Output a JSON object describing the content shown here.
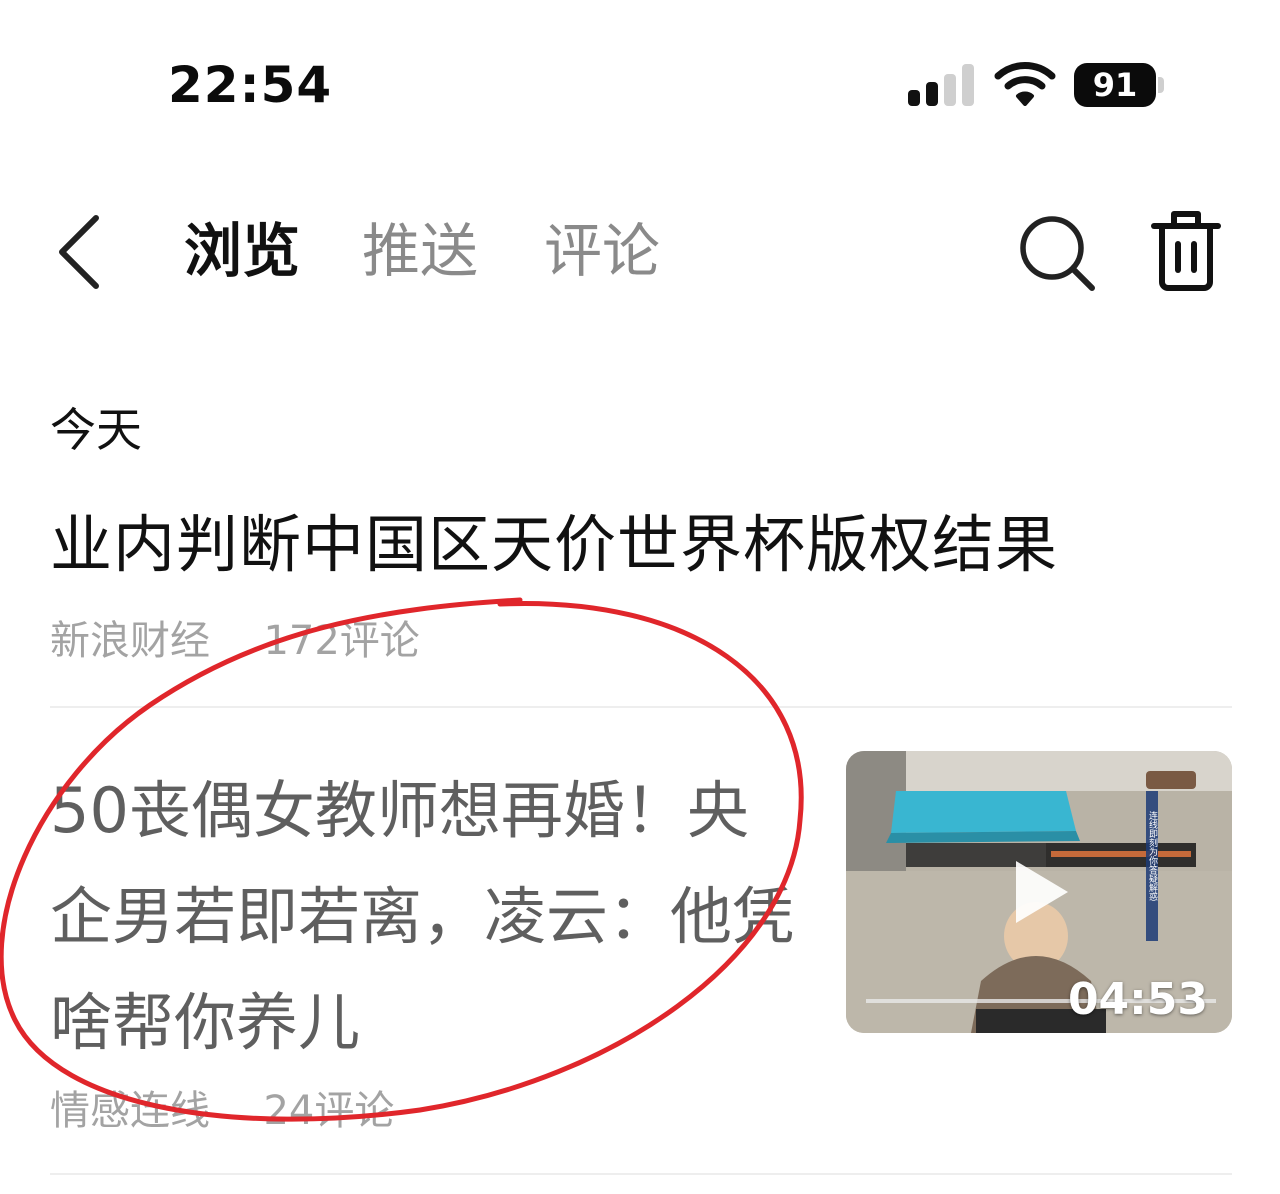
{
  "status_bar": {
    "time": "22:54",
    "battery_level": "91",
    "signal_bars_active": 2,
    "signal_bars_total": 4
  },
  "header": {
    "back_icon": "chevron-left-icon",
    "tabs": [
      {
        "label": "浏览",
        "active": true
      },
      {
        "label": "推送",
        "active": false
      },
      {
        "label": "评论",
        "active": false
      }
    ],
    "search_icon": "search-icon",
    "trash_icon": "trash-icon"
  },
  "section": {
    "title": "今天"
  },
  "news_items": [
    {
      "headline": "业内判断中国区天价世界杯版权结果",
      "source": "新浪财经",
      "comments": "172评论"
    },
    {
      "headline": "50丧偶女教师想再婚！央企男若即若离，凌云：他凭啥帮你养儿",
      "source": "情感连线",
      "comments": "24评论",
      "video_duration": "04:53",
      "video_caption": "连线即刻为你答疑解惑"
    }
  ],
  "colors": {
    "annotation": "#e0262b",
    "muted_text": "#a3a3a3",
    "pool": "#39b6d1"
  }
}
